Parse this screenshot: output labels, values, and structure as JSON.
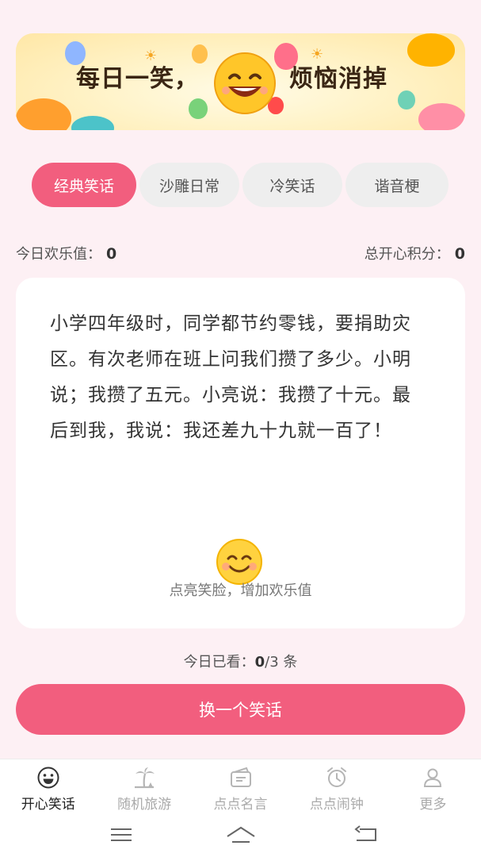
{
  "banner": {
    "title_left": "每日一笑，",
    "title_right": "烦恼消掉"
  },
  "tabs": [
    {
      "label": "经典笑话",
      "active": true
    },
    {
      "label": "沙雕日常",
      "active": false
    },
    {
      "label": "冷笑话",
      "active": false
    },
    {
      "label": "谐音梗",
      "active": false
    }
  ],
  "stats": {
    "today_label": "今日欢乐值：",
    "today_value": "0",
    "total_label": "总开心积分：",
    "total_value": "0"
  },
  "joke": {
    "text": "小学四年级时，同学都节约零钱，要捐助灾区。有次老师在班上问我们攒了多少。小明说；我攒了五元。小亮说：我攒了十元。最后到我，我说：我还差九十九就一百了！",
    "like_hint": "点亮笑脸，增加欢乐值"
  },
  "viewed": {
    "prefix": "今日已看：",
    "count": "0",
    "suffix": "/3 条"
  },
  "next_button": "换一个笑话",
  "nav": [
    {
      "label": "开心笑话",
      "icon": "smiley-icon",
      "active": true
    },
    {
      "label": "随机旅游",
      "icon": "palm-tree-icon",
      "active": false
    },
    {
      "label": "点点名言",
      "icon": "quote-card-icon",
      "active": false
    },
    {
      "label": "点点闹钟",
      "icon": "alarm-clock-icon",
      "active": false
    },
    {
      "label": "更多",
      "icon": "person-icon",
      "active": false
    }
  ],
  "colors": {
    "accent": "#f25e7e",
    "background": "#fdf0f4"
  }
}
